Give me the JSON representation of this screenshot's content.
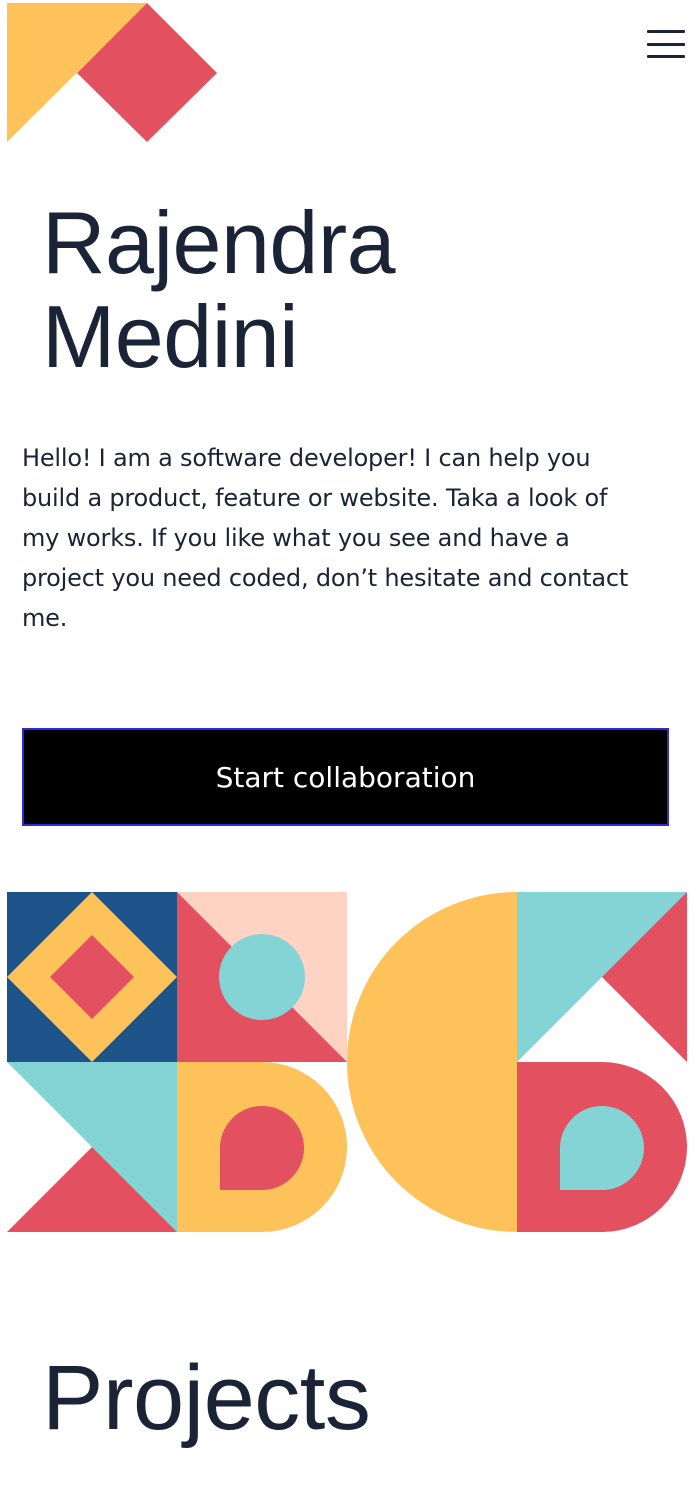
{
  "header": {
    "logo_icon": "geometric-logo-icon",
    "menu_icon": "hamburger-menu-icon"
  },
  "hero": {
    "name_line1": "Rajendra",
    "name_line2": "Medini",
    "intro": "Hello! I am a software developer! I can help you build a product, feature or website. Taka a look of my works. If you like what you see and have a project you need coded, don’t hesitate and contact me.",
    "cta_label": "Start collaboration"
  },
  "projects": {
    "title": "Projects"
  },
  "colors": {
    "yellow": "#fec25a",
    "red": "#e3505f",
    "navy": "#1c548a",
    "teal": "#84d4d6",
    "peach": "#ffd3c3",
    "text": "#1b2336",
    "button_bg": "#000000",
    "button_border": "#2e2bd4"
  }
}
